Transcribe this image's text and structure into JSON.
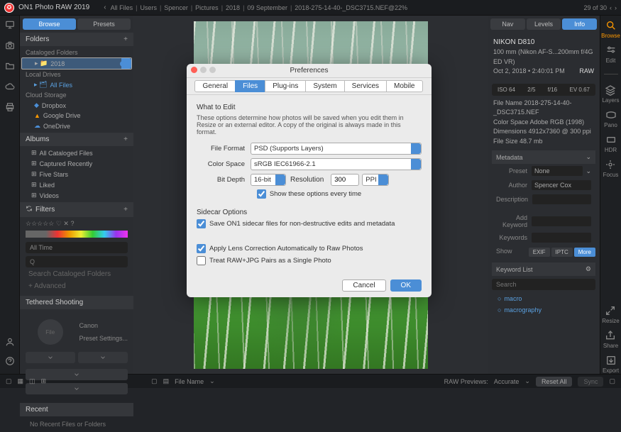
{
  "app_name": "ON1 Photo RAW 2019",
  "breadcrumbs": [
    "All Files",
    "Users",
    "Spencer",
    "Pictures",
    "2018",
    "09 September",
    "2018-275-14-40-_DSC3715.NEF@22%"
  ],
  "pager": "29 of 30",
  "left": {
    "tabs": {
      "browse": "Browse",
      "presets": "Presets"
    },
    "folders_hdr": "Folders",
    "cataloged": "Cataloged Folders",
    "folder_year": "2018",
    "local_drives": "Local Drives",
    "all_files": "All Files",
    "cloud_storage": "Cloud Storage",
    "cloud": [
      "Dropbox",
      "Google Drive",
      "OneDrive"
    ],
    "albums_hdr": "Albums",
    "albums": [
      "All Cataloged Files",
      "Captured Recently",
      "Five Stars",
      "Liked",
      "Videos"
    ],
    "filters_hdr": "Filters",
    "all_time": "All Time",
    "search_cataloged": "Search Cataloged Folders",
    "advanced": "+  Advanced",
    "tether_hdr": "Tethered Shooting",
    "tether_brand": "Canon",
    "tether_file": "File",
    "preset_settings": "Preset Settings...",
    "recent_hdr": "Recent",
    "no_recent": "No Recent Files or Folders"
  },
  "right": {
    "tabs": {
      "nav": "Nav",
      "levels": "Levels",
      "info": "Info"
    },
    "camera": "NIKON D810",
    "lens": "100 mm (Nikon AF-S...200mm f/4G ED VR)",
    "date": "Oct 2, 2018 • 2:40:01 PM",
    "raw_badge": "RAW",
    "params": {
      "iso": "ISO 64",
      "stops": "2/5",
      "fstop": "f/16",
      "ev": "EV 0.67"
    },
    "file_name": "File Name 2018-275-14-40-_DSC3715.NEF",
    "color_space": "Color Space Adobe RGB (1998)",
    "dimensions": "Dimensions 4912x7360 @ 300 ppi",
    "file_size": "File Size 48.7 mb",
    "metadata_hdr": "Metadata",
    "preset_lbl": "Preset",
    "preset_val": "None",
    "author_lbl": "Author",
    "author_val": "Spencer Cox",
    "desc_lbl": "Description",
    "addkw_lbl": "Add Keyword",
    "kw_lbl": "Keywords",
    "show": "Show",
    "exif": "EXIF",
    "iptc": "IPTC",
    "more": "More",
    "kwlist_hdr": "Keyword List",
    "kw_search": "Search",
    "kw_items": [
      "macro",
      "macrography"
    ]
  },
  "righticons": {
    "browse": "Browse",
    "edit": "Edit",
    "layers": "Layers",
    "pano": "Pano",
    "hdr": "HDR",
    "focus": "Focus",
    "resize": "Resize",
    "share": "Share",
    "export": "Export"
  },
  "modal": {
    "title": "Preferences",
    "tabs": [
      "General",
      "Files",
      "Plug-ins",
      "System",
      "Services",
      "Mobile"
    ],
    "active_tab": "Files",
    "what_to_edit": "What to Edit",
    "desc": "These options determine how photos will be saved when you edit them in Resize or an external editor.  A copy of the original is always made in this format.",
    "file_format_lbl": "File Format",
    "file_format": "PSD (Supports Layers)",
    "color_space_lbl": "Color Space",
    "color_space": "sRGB IEC61966-2.1",
    "bit_depth_lbl": "Bit Depth",
    "bit_depth": "16-bit",
    "resolution_lbl": "Resolution",
    "resolution": "300",
    "ppi": "PPI",
    "show_every": "Show these options every time",
    "sidecar_hdr": "Sidecar Options",
    "save_sidecar": "Save ON1 sidecar files for non-destructive edits and metadata",
    "lens_corr": "Apply Lens Correction Automatically to Raw Photos",
    "treat_raw": "Treat RAW+JPG Pairs as a Single Photo",
    "cancel": "Cancel",
    "ok": "OK"
  },
  "bottom": {
    "file_name_lbl": "File Name",
    "raw_previews": "RAW Previews:",
    "accurate": "Accurate",
    "reset_all": "Reset All",
    "sync": "Sync"
  }
}
